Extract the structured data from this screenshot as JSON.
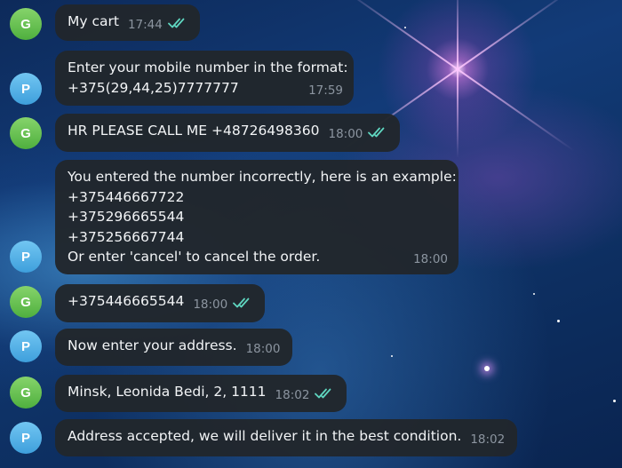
{
  "colors": {
    "check": "#5fd6c0",
    "bubble": "#21262c",
    "avatar_g": "#5fbf48",
    "avatar_p": "#4aa8e0"
  },
  "messages": [
    {
      "avatar": "G",
      "text": "My cart",
      "time": "17:44",
      "read": true
    },
    {
      "avatar": "P",
      "text": "Enter your mobile number in the format:\n+375(29,44,25)7777777",
      "time": "17:59",
      "read": false
    },
    {
      "avatar": "G",
      "text": "HR PLEASE CALL ME +48726498360",
      "time": "18:00",
      "read": true
    },
    {
      "avatar": "P",
      "text": "You entered the number incorrectly, here is an example:\n+375446667722\n+375296665544\n+375256667744\nOr enter 'cancel' to cancel the order.",
      "time": "18:00",
      "read": false
    },
    {
      "avatar": "G",
      "text": "+375446665544",
      "time": "18:00",
      "read": true
    },
    {
      "avatar": "P",
      "text": "Now enter your address.",
      "time": "18:00",
      "read": false
    },
    {
      "avatar": "G",
      "text": "Minsk, Leonida Bedi, 2, 1111",
      "time": "18:02",
      "read": true
    },
    {
      "avatar": "P",
      "text": "Address accepted, we will deliver it in the best condition.",
      "time": "18:02",
      "read": false
    }
  ]
}
